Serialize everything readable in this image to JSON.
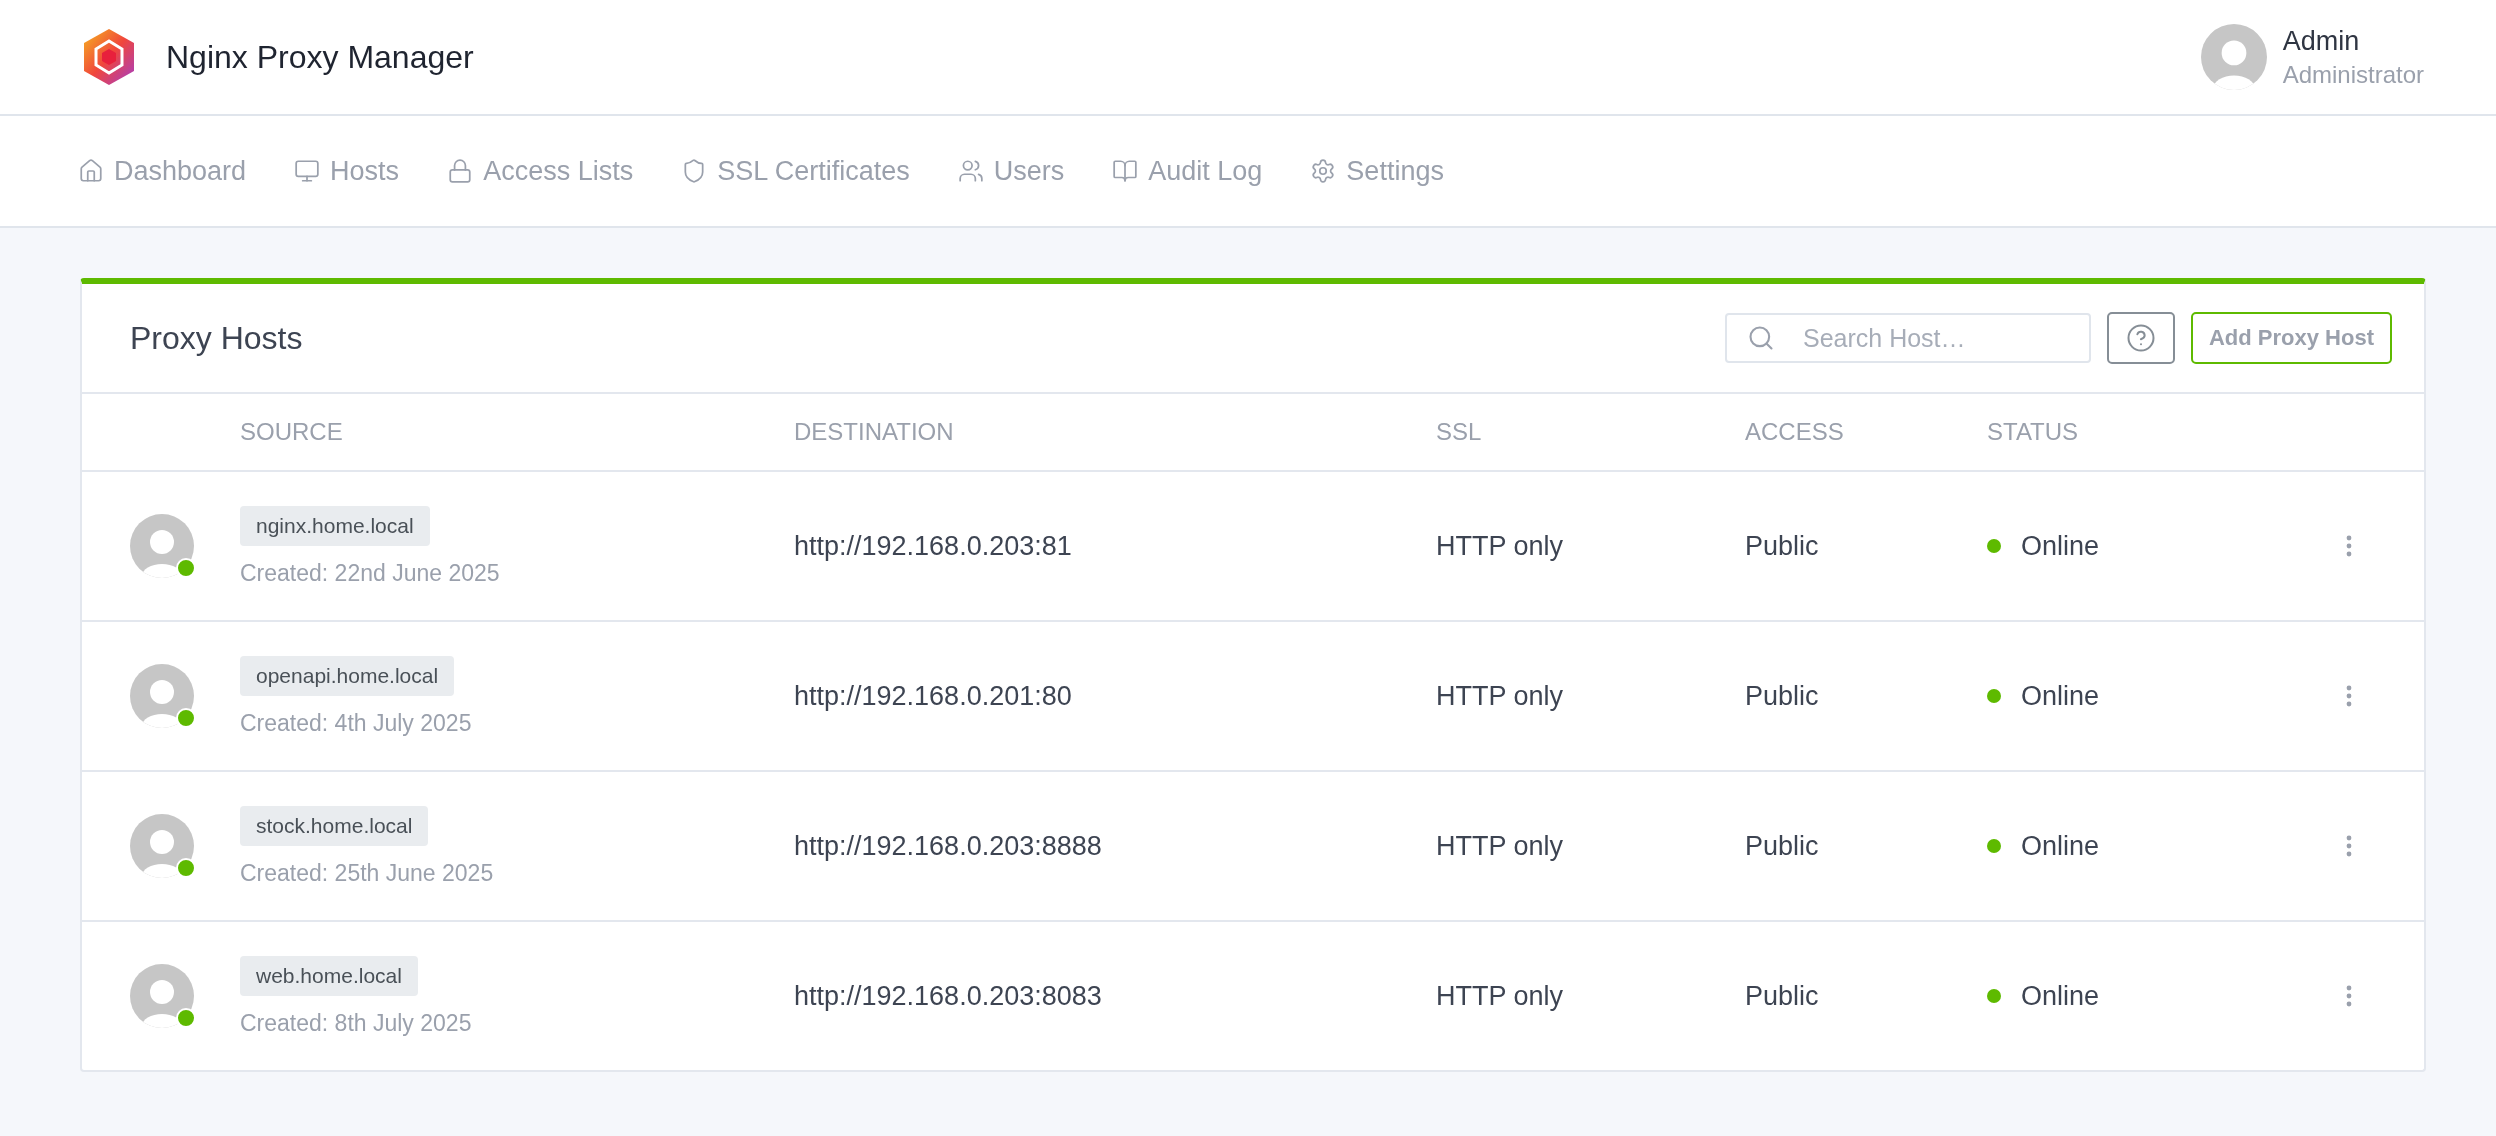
{
  "app": {
    "title": "Nginx Proxy Manager"
  },
  "user": {
    "name": "Admin",
    "role": "Administrator"
  },
  "nav": [
    {
      "label": "Dashboard"
    },
    {
      "label": "Hosts"
    },
    {
      "label": "Access Lists"
    },
    {
      "label": "SSL Certificates"
    },
    {
      "label": "Users"
    },
    {
      "label": "Audit Log"
    },
    {
      "label": "Settings"
    }
  ],
  "card": {
    "title": "Proxy Hosts",
    "search": {
      "placeholder": "Search Host…"
    },
    "add_button": "Add Proxy Host"
  },
  "table": {
    "columns": [
      "SOURCE",
      "DESTINATION",
      "SSL",
      "ACCESS",
      "STATUS"
    ],
    "rows": [
      {
        "domain": "nginx.home.local",
        "created": "Created: 22nd June 2025",
        "destination": "http://192.168.0.203:81",
        "ssl": "HTTP only",
        "access": "Public",
        "status": "Online",
        "online": true
      },
      {
        "domain": "openapi.home.local",
        "created": "Created: 4th July 2025",
        "destination": "http://192.168.0.201:80",
        "ssl": "HTTP only",
        "access": "Public",
        "status": "Online",
        "online": true
      },
      {
        "domain": "stock.home.local",
        "created": "Created: 25th June 2025",
        "destination": "http://192.168.0.203:8888",
        "ssl": "HTTP only",
        "access": "Public",
        "status": "Online",
        "online": true
      },
      {
        "domain": "web.home.local",
        "created": "Created: 8th July 2025",
        "destination": "http://192.168.0.203:8083",
        "ssl": "HTTP only",
        "access": "Public",
        "status": "Online",
        "online": true
      }
    ]
  }
}
